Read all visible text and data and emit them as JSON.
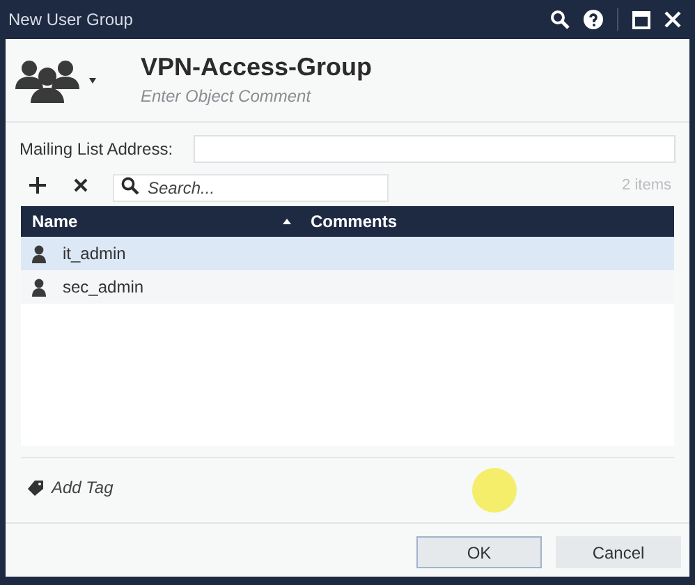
{
  "window": {
    "title": "New User Group"
  },
  "header": {
    "title": "VPN-Access-Group",
    "comment_placeholder": "Enter Object Comment"
  },
  "mailing_list": {
    "label": "Mailing List Address:"
  },
  "search": {
    "placeholder": "Search..."
  },
  "item_count": "2 items",
  "table": {
    "columns": [
      {
        "label": "Name",
        "sorted": true
      },
      {
        "label": "Comments",
        "sorted": false
      }
    ],
    "rows": [
      {
        "name": "it_admin",
        "selected": true
      },
      {
        "name": "sec_admin",
        "selected": false
      }
    ]
  },
  "add_tag": "Add Tag",
  "buttons": [
    {
      "label": "OK",
      "default": true
    },
    {
      "label": "Cancel",
      "default": false
    }
  ]
}
